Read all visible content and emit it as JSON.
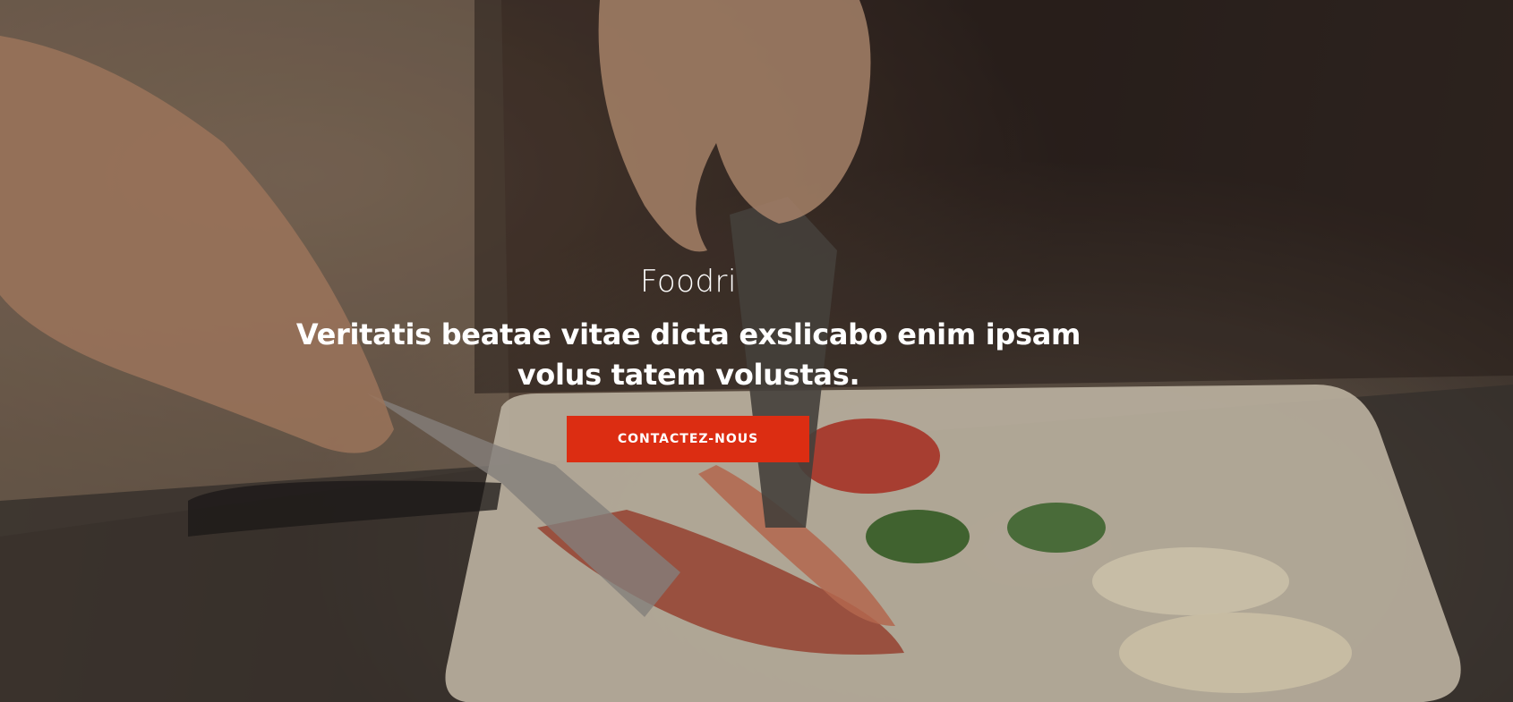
{
  "hero": {
    "brand": "Foodri",
    "headline": "Veritatis beatae vitae dicta exslicabo enim ipsam volus tatem volustas.",
    "cta_label": "CONTACTEZ-NOUS",
    "background_image": "chef-plating-shrimp-photo"
  },
  "colors": {
    "accent": "#dc2d12",
    "text": "#ffffff"
  }
}
